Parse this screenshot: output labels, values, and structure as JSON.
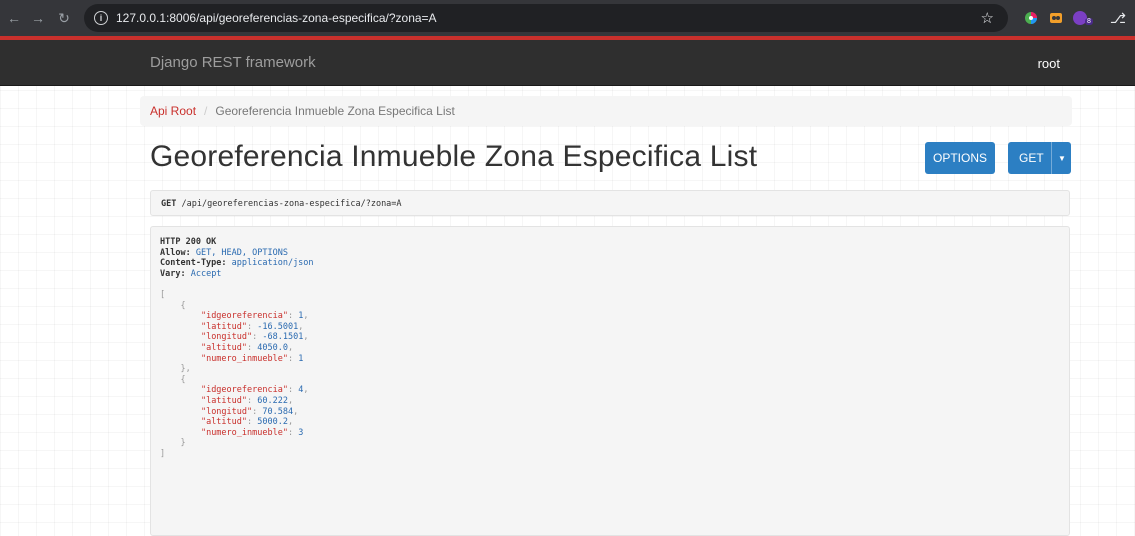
{
  "browser": {
    "url": "127.0.0.1:8006/api/georeferencias-zona-especifica/?zona=A",
    "back_icon": "arrow-left-icon",
    "forward_icon": "arrow-right-icon",
    "reload_icon": "reload-icon",
    "star_icon": "star-icon",
    "extension_badge": "8"
  },
  "navbar": {
    "brand": "Django REST framework",
    "user": "root"
  },
  "breadcrumb": {
    "root": "Api Root",
    "separator": "/",
    "current": "Georeferencia Inmueble Zona Especifica List"
  },
  "page": {
    "title": "Georeferencia Inmueble Zona Especifica List",
    "options_label": "OPTIONS",
    "get_label": "GET",
    "accent_color": "#2c7fc3",
    "brand_red": "#c9302c"
  },
  "request": {
    "method": "GET",
    "path": "/api/georeferencias-zona-especifica/?zona=A"
  },
  "response": {
    "status": "HTTP 200 OK",
    "headers": [
      {
        "key": "Allow:",
        "value": "GET, HEAD, OPTIONS"
      },
      {
        "key": "Content-Type:",
        "value": "application/json"
      },
      {
        "key": "Vary:",
        "value": "Accept"
      }
    ],
    "body": [
      {
        "idgeoreferencia": "1",
        "latitud": "-16.5001",
        "longitud": "-68.1501",
        "altitud": "4050.0",
        "numero_inmueble": "1"
      },
      {
        "idgeoreferencia": "4",
        "latitud": "60.222",
        "longitud": "70.584",
        "altitud": "5000.2",
        "numero_inmueble": "3"
      }
    ]
  }
}
